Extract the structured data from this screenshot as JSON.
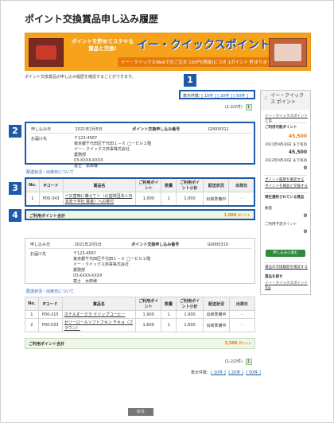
{
  "page": {
    "title": "ポイント交換賞品申し込み履歴",
    "intro": "ポイント交換賞品の申し込み履歴を確認することができます。"
  },
  "banner": {
    "catch": "ポイントを貯めてステキな賞品と交換!",
    "brand": "イー・クイックスポイント",
    "sub": "イー・クイックスWebでのご注文 100円(税抜)につき 1ポイント 貯まります!"
  },
  "markers": [
    "1",
    "2",
    "3",
    "4"
  ],
  "pager": {
    "label": "表示件数:",
    "opt1": "[ 10件 ]",
    "opt2": "[ 20件 ]",
    "opt3": "[ 50件 ]",
    "info": "(1-2/2件)",
    "page": "1"
  },
  "order1": {
    "date_label": "申し込み日",
    "date": "2021年2月5日",
    "no_label": "ポイント交換申し込み番号",
    "no": "G0000311",
    "ship_label": "お届け先",
    "addr1": "〒123-4567",
    "addr2": "東京都千代田区千代田１－Ｘ ◯ービル２階",
    "addr3": "イー・クイックス商事株式会社",
    "addr4": "業務部",
    "addr5": "03-XXXX-XXXX",
    "addr6": "富士　太郎様",
    "status_link": "配送状況・出荷日について",
    "head_no": "No.",
    "head_code": "Pコード",
    "head_name": "賞品名",
    "head_pt": "ご利用ポイント",
    "head_qty": "数量",
    "head_sub": "ご利用ポイント小計",
    "head_status": "配送状況",
    "head_ship": "出荷日",
    "rows": [
      {
        "no": "1",
        "code": "P00-343",
        "name": "＜災害時に備えて＞（公益財団法人日本赤十字社 募金）への寄付",
        "pt": "1,000",
        "qty": "1",
        "sub": "1,000",
        "status": "出荷準備中",
        "ship": "-"
      }
    ],
    "total_label": "ご利用ポイント合計",
    "total": "1,000",
    "unit": "ポイント"
  },
  "order2": {
    "date_label": "申し込み日",
    "date": "2021年2月5日",
    "no_label": "ポイント交換申し込み番号",
    "no": "G0000310",
    "ship_label": "お届け先",
    "addr1": "〒123-4567",
    "addr2": "東京都千代田区千代田１－Ｘ ◯ービル２階",
    "addr3": "イー・クイックス商事株式会社",
    "addr4": "業務部",
    "addr5": "03-XXXX-XXXX",
    "addr6": "富士　太郎様",
    "status_link": "配送状況・出荷日について",
    "head_no": "No.",
    "head_code": "Pコード",
    "head_name": "賞品名",
    "head_pt": "ご利用ポイント",
    "head_qty": "数量",
    "head_sub": "ご利用ポイント小計",
    "head_status": "配送状況",
    "head_ship": "出荷日",
    "rows": [
      {
        "no": "1",
        "code": "P00-215",
        "name": "ホテルオークラ ドリップコーヒー",
        "pt": "1,900",
        "qty": "1",
        "sub": "1,900",
        "status": "出荷準備中",
        "ship": "-"
      },
      {
        "no": "2",
        "code": "P00-033",
        "name": "ゼリーロールソフトフキン チキョ（ブラウン）",
        "pt": "1,600",
        "qty": "1",
        "sub": "1,600",
        "status": "出荷準備中",
        "ship": "-"
      }
    ],
    "total_label": "ご利用ポイント合計",
    "total": "3,500",
    "unit": "ポイント"
  },
  "sidebar": {
    "title": "イー・クイックス ポイント",
    "link_about": "イー・クイックスポイントとは",
    "avail_label": "ご利用可能ポイント",
    "avail": "45,500",
    "exp1_label": "2021年9月30日 まで有効",
    "exp1": "45,500",
    "exp2_label": "2022年9月30日 まで有効",
    "exp2": "0",
    "link_history": "ポイント履歴を確認する",
    "link_exchange": "ポイントを賞品と交換する",
    "sel_label": "現在選択されている賞品",
    "qty_label": "数量",
    "qty": "0",
    "use_label": "ご利用予定ポイント",
    "use": "0",
    "btn": "申し込みに進む",
    "hist_label": "賞品の交換履歴を確認する",
    "search_label": "賞品を探す",
    "search_link": "イー・クイックスポイントTop"
  },
  "back": "戻る",
  "colors": {
    "accent": "#1e5aa8",
    "orange": "#e67b0a",
    "green": "#2f8a3f"
  }
}
